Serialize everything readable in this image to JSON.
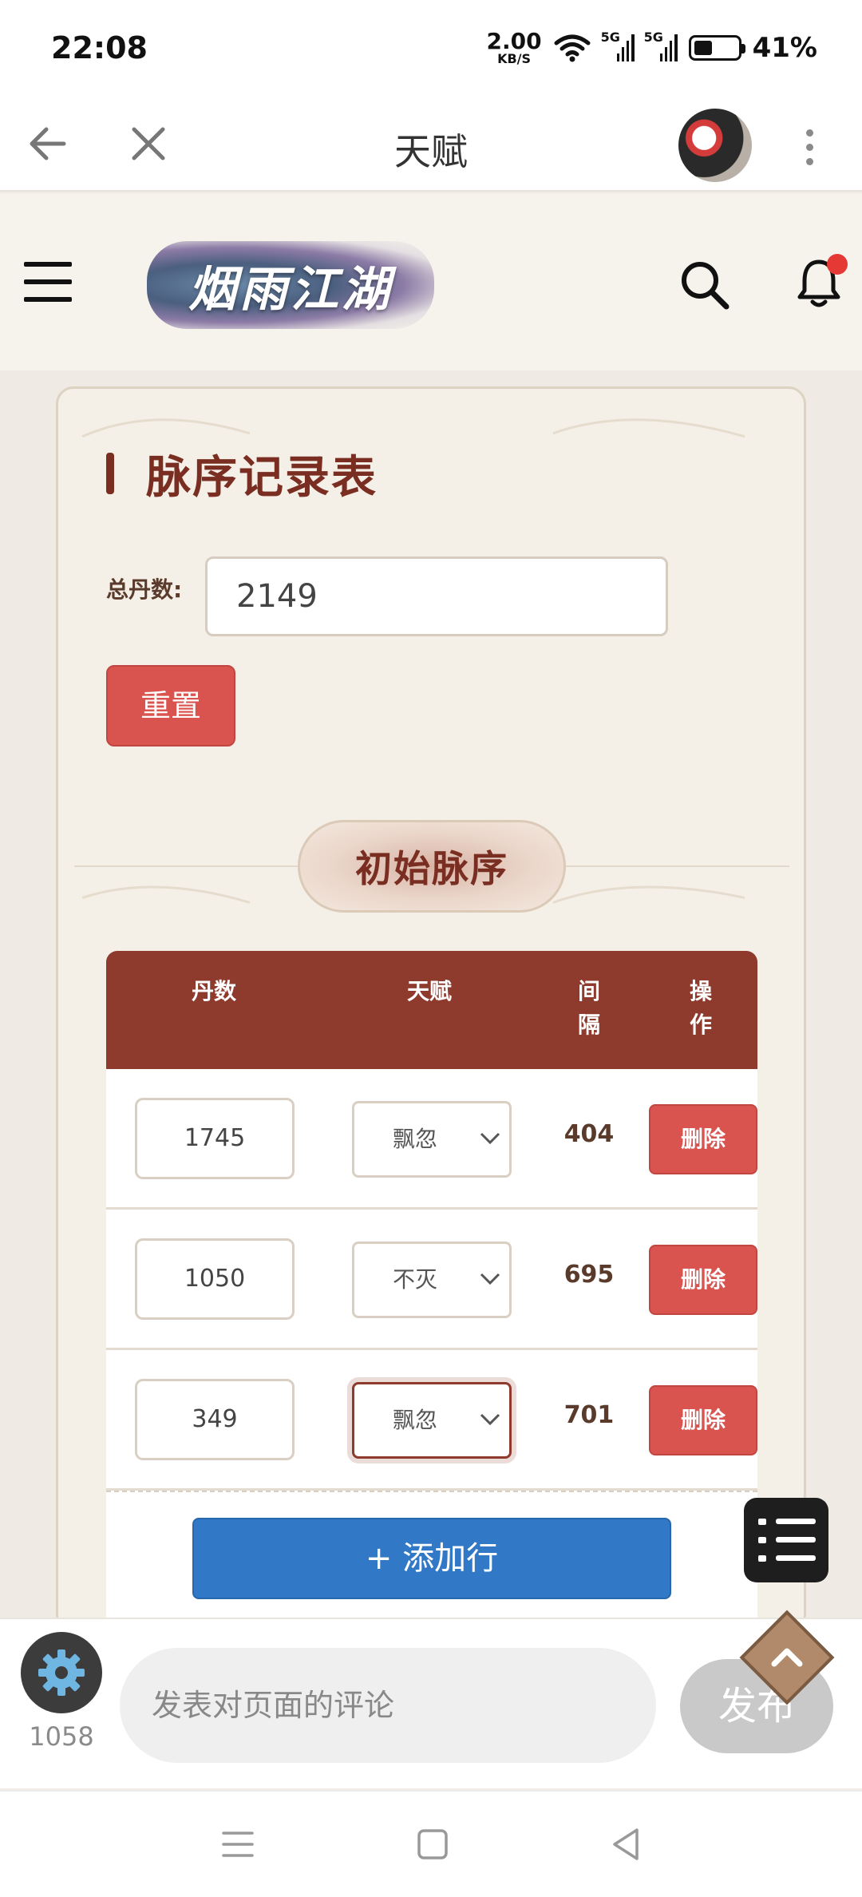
{
  "status_bar": {
    "time": "22:08",
    "net_speed_value": "2.00",
    "net_speed_unit": "KB/S",
    "signal1_label": "5G",
    "signal2_label": "5G",
    "battery_level": 0.41,
    "battery_text": "41%"
  },
  "title_bar": {
    "title": "天赋",
    "back_icon": "arrow-left-icon",
    "close_icon": "close-icon",
    "more_icon": "more-vertical-icon"
  },
  "site_header": {
    "logo_text": "烟雨江湖",
    "menu_icon": "hamburger-icon",
    "search_icon": "search-icon",
    "bell_icon": "bell-icon",
    "notification_dot_color": "#e53935"
  },
  "card": {
    "title": "脉序记录表",
    "total_label": "总丹数:",
    "total_value": "2149",
    "reset_label": "重置",
    "section_title": "初始脉序",
    "table": {
      "headers": {
        "dan": "丹数",
        "talent": "天赋",
        "interval_line1": "间",
        "interval_line2": "隔",
        "action_line1": "操",
        "action_line2": "作"
      },
      "rows": [
        {
          "dan": "1745",
          "talent": "飘忽",
          "interval": "404",
          "action": "删除"
        },
        {
          "dan": "1050",
          "talent": "不灭",
          "interval": "695",
          "action": "删除"
        },
        {
          "dan": "349",
          "talent": "飘忽",
          "interval": "701",
          "action": "删除"
        }
      ],
      "add_row_label": "+ 添加行"
    },
    "colors": {
      "header_bg": "#8e3b2e",
      "title_color": "#7a2e22",
      "danger": "#d9534f",
      "primary": "#3178c6"
    }
  },
  "floating_menu": {
    "icon": "list-icon"
  },
  "comment_bar": {
    "settings_icon": "gear-icon",
    "count": "1058",
    "placeholder": "发表对页面的评论",
    "publish_label": "发布",
    "scroll_top_icon": "chevron-up-icon"
  },
  "nav_bar": {
    "menu_icon": "menu-lines-icon",
    "home_icon": "square-icon",
    "back_icon": "triangle-back-icon"
  }
}
